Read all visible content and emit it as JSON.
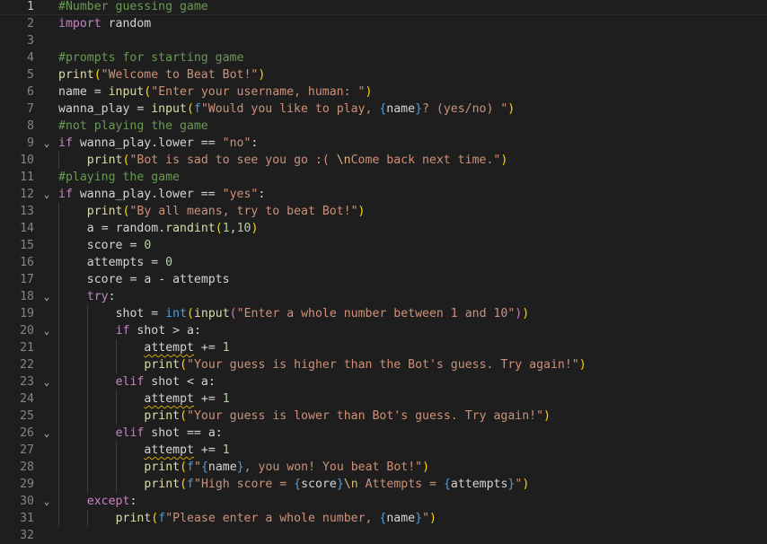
{
  "editor": {
    "language": "python",
    "current_line": 1,
    "lines": [
      {
        "n": "1",
        "fold": false,
        "indent": 0,
        "tokens": [
          {
            "t": "#Number guessing game",
            "c": "comment"
          }
        ]
      },
      {
        "n": "2",
        "fold": false,
        "indent": 0,
        "tokens": [
          {
            "t": "import",
            "c": "kw"
          },
          {
            "t": " random",
            "c": "plain"
          }
        ]
      },
      {
        "n": "3",
        "fold": false,
        "indent": 0,
        "tokens": []
      },
      {
        "n": "4",
        "fold": false,
        "indent": 0,
        "tokens": [
          {
            "t": "#prompts for starting game",
            "c": "comment"
          }
        ]
      },
      {
        "n": "5",
        "fold": false,
        "indent": 0,
        "tokens": [
          {
            "t": "print",
            "c": "fn"
          },
          {
            "t": "(",
            "c": "p1"
          },
          {
            "t": "\"Welcome to Beat Bot!\"",
            "c": "str"
          },
          {
            "t": ")",
            "c": "p1"
          }
        ]
      },
      {
        "n": "6",
        "fold": false,
        "indent": 0,
        "tokens": [
          {
            "t": "name",
            "c": "plain"
          },
          {
            "t": " = ",
            "c": "plain"
          },
          {
            "t": "input",
            "c": "fn"
          },
          {
            "t": "(",
            "c": "p1"
          },
          {
            "t": "\"Enter your username, human: \"",
            "c": "str"
          },
          {
            "t": ")",
            "c": "p1"
          }
        ]
      },
      {
        "n": "7",
        "fold": false,
        "indent": 0,
        "tokens": [
          {
            "t": "wanna_play",
            "c": "plain"
          },
          {
            "t": " = ",
            "c": "plain"
          },
          {
            "t": "input",
            "c": "fn"
          },
          {
            "t": "(",
            "c": "p1"
          },
          {
            "t": "f",
            "c": "kw2"
          },
          {
            "t": "\"Would you like to play, ",
            "c": "str"
          },
          {
            "t": "{",
            "c": "brace"
          },
          {
            "t": "name",
            "c": "plain"
          },
          {
            "t": "}",
            "c": "brace"
          },
          {
            "t": "? (yes/no) \"",
            "c": "str"
          },
          {
            "t": ")",
            "c": "p1"
          }
        ]
      },
      {
        "n": "8",
        "fold": false,
        "indent": 0,
        "tokens": [
          {
            "t": "#not playing the game",
            "c": "comment"
          }
        ]
      },
      {
        "n": "9",
        "fold": true,
        "indent": 0,
        "tokens": [
          {
            "t": "if",
            "c": "kw"
          },
          {
            "t": " wanna_play.lower == ",
            "c": "plain"
          },
          {
            "t": "\"no\"",
            "c": "str"
          },
          {
            "t": ":",
            "c": "plain"
          }
        ]
      },
      {
        "n": "10",
        "fold": false,
        "indent": 1,
        "tokens": [
          {
            "t": "print",
            "c": "fn"
          },
          {
            "t": "(",
            "c": "p1"
          },
          {
            "t": "\"Bot is sad to see you go :( ",
            "c": "str"
          },
          {
            "t": "\\n",
            "c": "esc"
          },
          {
            "t": "Come back next time.\"",
            "c": "str"
          },
          {
            "t": ")",
            "c": "p1"
          }
        ]
      },
      {
        "n": "11",
        "fold": false,
        "indent": 0,
        "tokens": [
          {
            "t": "#playing the game",
            "c": "comment"
          }
        ]
      },
      {
        "n": "12",
        "fold": true,
        "indent": 0,
        "tokens": [
          {
            "t": "if",
            "c": "kw"
          },
          {
            "t": " wanna_play.lower == ",
            "c": "plain"
          },
          {
            "t": "\"yes\"",
            "c": "str"
          },
          {
            "t": ":",
            "c": "plain"
          }
        ]
      },
      {
        "n": "13",
        "fold": false,
        "indent": 1,
        "tokens": [
          {
            "t": "print",
            "c": "fn"
          },
          {
            "t": "(",
            "c": "p1"
          },
          {
            "t": "\"By all means, try to beat Bot!\"",
            "c": "str"
          },
          {
            "t": ")",
            "c": "p1"
          }
        ]
      },
      {
        "n": "14",
        "fold": false,
        "indent": 1,
        "tokens": [
          {
            "t": "a",
            "c": "plain"
          },
          {
            "t": " = random.",
            "c": "plain"
          },
          {
            "t": "randint",
            "c": "fn"
          },
          {
            "t": "(",
            "c": "p1"
          },
          {
            "t": "1",
            "c": "num"
          },
          {
            "t": ",",
            "c": "plain"
          },
          {
            "t": "10",
            "c": "num"
          },
          {
            "t": ")",
            "c": "p1"
          }
        ]
      },
      {
        "n": "15",
        "fold": false,
        "indent": 1,
        "tokens": [
          {
            "t": "score",
            "c": "plain"
          },
          {
            "t": " = ",
            "c": "plain"
          },
          {
            "t": "0",
            "c": "num"
          }
        ]
      },
      {
        "n": "16",
        "fold": false,
        "indent": 1,
        "tokens": [
          {
            "t": "attempts",
            "c": "plain"
          },
          {
            "t": " = ",
            "c": "plain"
          },
          {
            "t": "0",
            "c": "num"
          }
        ]
      },
      {
        "n": "17",
        "fold": false,
        "indent": 1,
        "tokens": [
          {
            "t": "score",
            "c": "plain"
          },
          {
            "t": " = a - attempts",
            "c": "plain"
          }
        ]
      },
      {
        "n": "18",
        "fold": true,
        "indent": 1,
        "tokens": [
          {
            "t": "try",
            "c": "kw"
          },
          {
            "t": ":",
            "c": "plain"
          }
        ]
      },
      {
        "n": "19",
        "fold": false,
        "indent": 2,
        "tokens": [
          {
            "t": "shot",
            "c": "plain"
          },
          {
            "t": " = ",
            "c": "plain"
          },
          {
            "t": "int",
            "c": "kw2"
          },
          {
            "t": "(",
            "c": "p1"
          },
          {
            "t": "input",
            "c": "fn"
          },
          {
            "t": "(",
            "c": "p2"
          },
          {
            "t": "\"Enter a whole number between 1 and 10\"",
            "c": "str"
          },
          {
            "t": ")",
            "c": "p2"
          },
          {
            "t": ")",
            "c": "p1"
          }
        ]
      },
      {
        "n": "20",
        "fold": true,
        "indent": 2,
        "tokens": [
          {
            "t": "if",
            "c": "kw"
          },
          {
            "t": " shot > a:",
            "c": "plain"
          }
        ]
      },
      {
        "n": "21",
        "fold": false,
        "indent": 3,
        "tokens": [
          {
            "t": "attempt",
            "c": "plain",
            "sq": true
          },
          {
            "t": " += ",
            "c": "plain"
          },
          {
            "t": "1",
            "c": "num"
          }
        ]
      },
      {
        "n": "22",
        "fold": false,
        "indent": 3,
        "tokens": [
          {
            "t": "print",
            "c": "fn"
          },
          {
            "t": "(",
            "c": "p1"
          },
          {
            "t": "\"Your guess is higher than the Bot's guess. Try again!\"",
            "c": "str"
          },
          {
            "t": ")",
            "c": "p1"
          }
        ]
      },
      {
        "n": "23",
        "fold": true,
        "indent": 2,
        "tokens": [
          {
            "t": "elif",
            "c": "kw"
          },
          {
            "t": " shot < a:",
            "c": "plain"
          }
        ]
      },
      {
        "n": "24",
        "fold": false,
        "indent": 3,
        "tokens": [
          {
            "t": "attempt",
            "c": "plain",
            "sq": true
          },
          {
            "t": " += ",
            "c": "plain"
          },
          {
            "t": "1",
            "c": "num"
          }
        ]
      },
      {
        "n": "25",
        "fold": false,
        "indent": 3,
        "tokens": [
          {
            "t": "print",
            "c": "fn"
          },
          {
            "t": "(",
            "c": "p1"
          },
          {
            "t": "\"Your guess is lower than Bot's guess. Try again!\"",
            "c": "str"
          },
          {
            "t": ")",
            "c": "p1"
          }
        ]
      },
      {
        "n": "26",
        "fold": true,
        "indent": 2,
        "tokens": [
          {
            "t": "elif",
            "c": "kw"
          },
          {
            "t": " shot == a:",
            "c": "plain"
          }
        ]
      },
      {
        "n": "27",
        "fold": false,
        "indent": 3,
        "tokens": [
          {
            "t": "attempt",
            "c": "plain",
            "sq": true
          },
          {
            "t": " += ",
            "c": "plain"
          },
          {
            "t": "1",
            "c": "num"
          }
        ]
      },
      {
        "n": "28",
        "fold": false,
        "indent": 3,
        "tokens": [
          {
            "t": "print",
            "c": "fn"
          },
          {
            "t": "(",
            "c": "p1"
          },
          {
            "t": "f",
            "c": "kw2"
          },
          {
            "t": "\"",
            "c": "str"
          },
          {
            "t": "{",
            "c": "brace"
          },
          {
            "t": "name",
            "c": "plain"
          },
          {
            "t": "}",
            "c": "brace"
          },
          {
            "t": ", you won! You beat Bot!\"",
            "c": "str"
          },
          {
            "t": ")",
            "c": "p1"
          }
        ]
      },
      {
        "n": "29",
        "fold": false,
        "indent": 3,
        "tokens": [
          {
            "t": "print",
            "c": "fn"
          },
          {
            "t": "(",
            "c": "p1"
          },
          {
            "t": "f",
            "c": "kw2"
          },
          {
            "t": "\"High score = ",
            "c": "str"
          },
          {
            "t": "{",
            "c": "brace"
          },
          {
            "t": "score",
            "c": "plain"
          },
          {
            "t": "}",
            "c": "brace"
          },
          {
            "t": "\\n",
            "c": "esc"
          },
          {
            "t": " Attempts = ",
            "c": "str"
          },
          {
            "t": "{",
            "c": "brace"
          },
          {
            "t": "attempts",
            "c": "plain"
          },
          {
            "t": "}",
            "c": "brace"
          },
          {
            "t": "\"",
            "c": "str"
          },
          {
            "t": ")",
            "c": "p1"
          }
        ]
      },
      {
        "n": "30",
        "fold": true,
        "indent": 1,
        "tokens": [
          {
            "t": "except",
            "c": "kw"
          },
          {
            "t": ":",
            "c": "plain"
          }
        ]
      },
      {
        "n": "31",
        "fold": false,
        "indent": 2,
        "tokens": [
          {
            "t": "print",
            "c": "fn"
          },
          {
            "t": "(",
            "c": "p1"
          },
          {
            "t": "f",
            "c": "kw2"
          },
          {
            "t": "\"Please enter a whole number, ",
            "c": "str"
          },
          {
            "t": "{",
            "c": "brace"
          },
          {
            "t": "name",
            "c": "plain"
          },
          {
            "t": "}",
            "c": "brace"
          },
          {
            "t": "\"",
            "c": "str"
          },
          {
            "t": ")",
            "c": "p1"
          }
        ]
      },
      {
        "n": "32",
        "fold": false,
        "indent": 0,
        "tokens": []
      }
    ],
    "fold_icon": "chevron-down-icon",
    "fold_glyph": "⌄"
  }
}
